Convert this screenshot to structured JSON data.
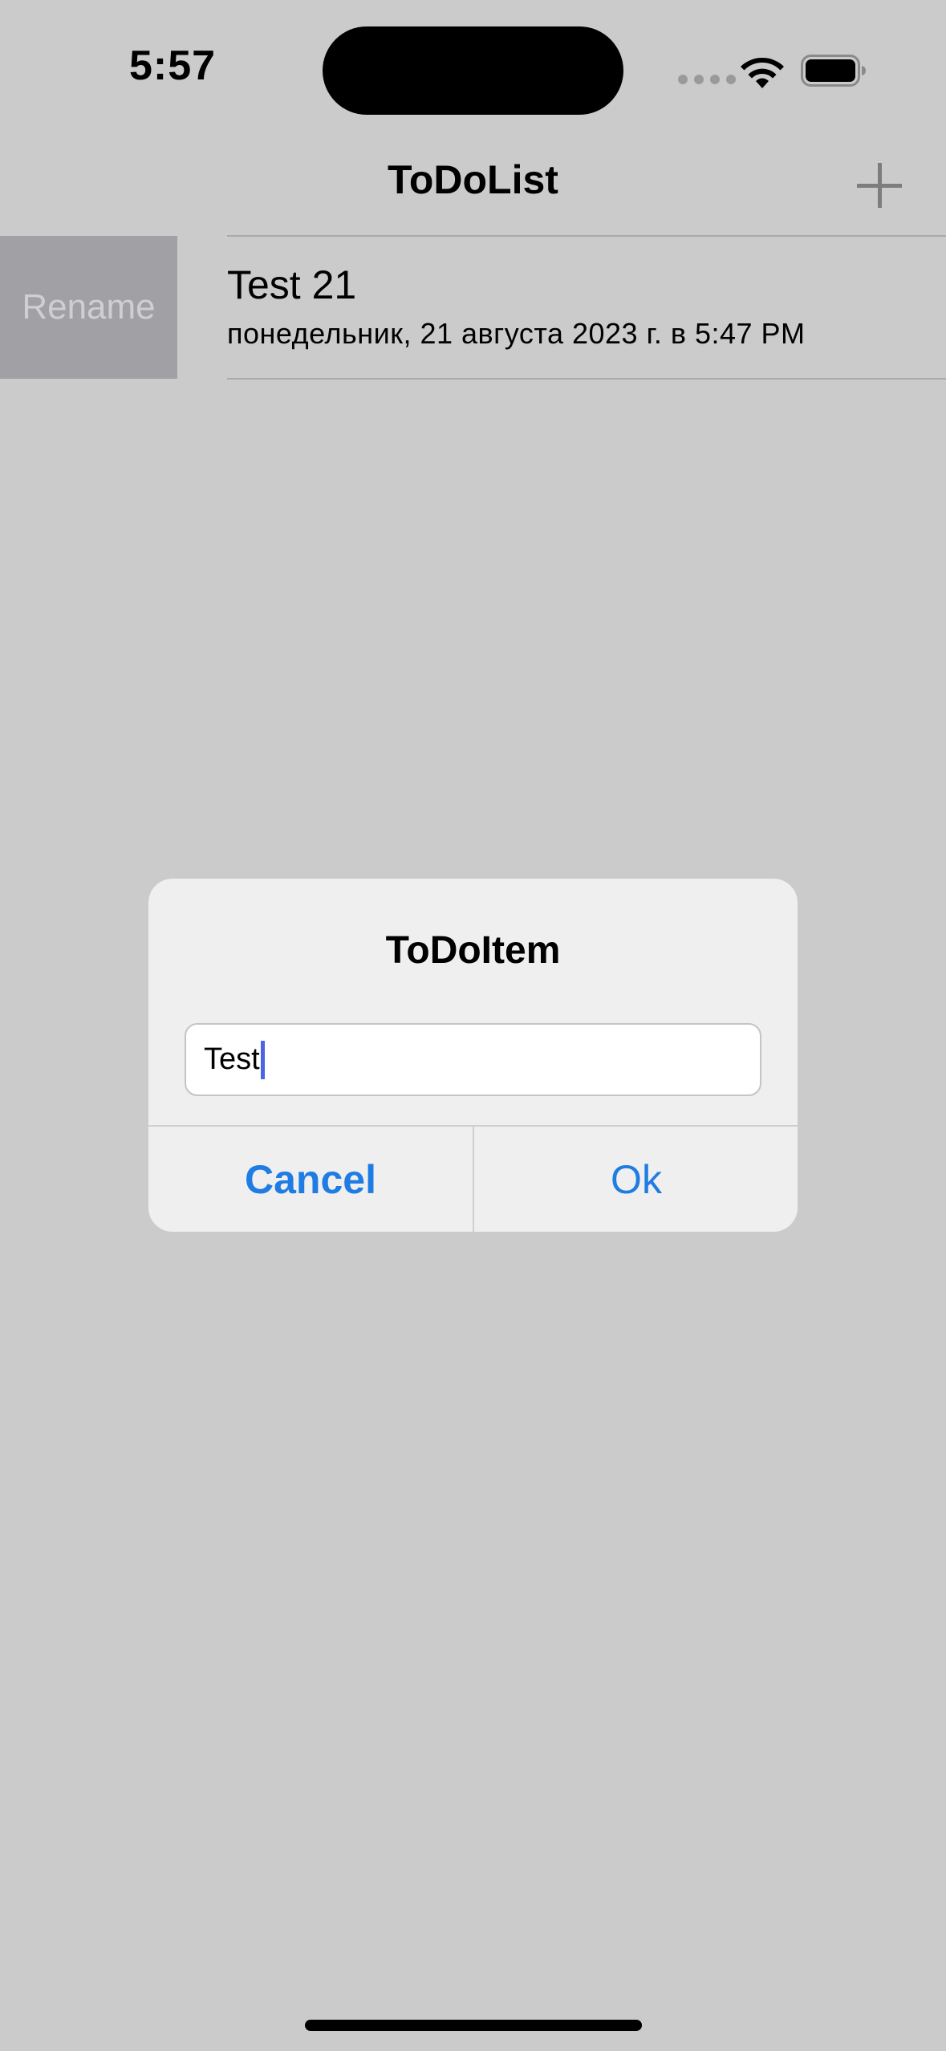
{
  "status_bar": {
    "time": "5:57",
    "icons": [
      "cellular-signal-icon",
      "wifi-icon",
      "battery-icon"
    ]
  },
  "nav": {
    "title": "ToDoList",
    "add_icon": "plus-icon"
  },
  "list": {
    "items": [
      {
        "title": "Test 21",
        "subtitle": "понедельник, 21 августа 2023 г. в 5:47 PM",
        "swipe_action": "Rename"
      }
    ]
  },
  "alert": {
    "title": "ToDoItem",
    "input_value": "Test",
    "cancel_label": "Cancel",
    "ok_label": "Ok"
  },
  "colors": {
    "background": "#cbcbcb",
    "accent": "#1f7ce3",
    "swipe_action": "#a1a1a5",
    "alert_background": "#efefef"
  }
}
